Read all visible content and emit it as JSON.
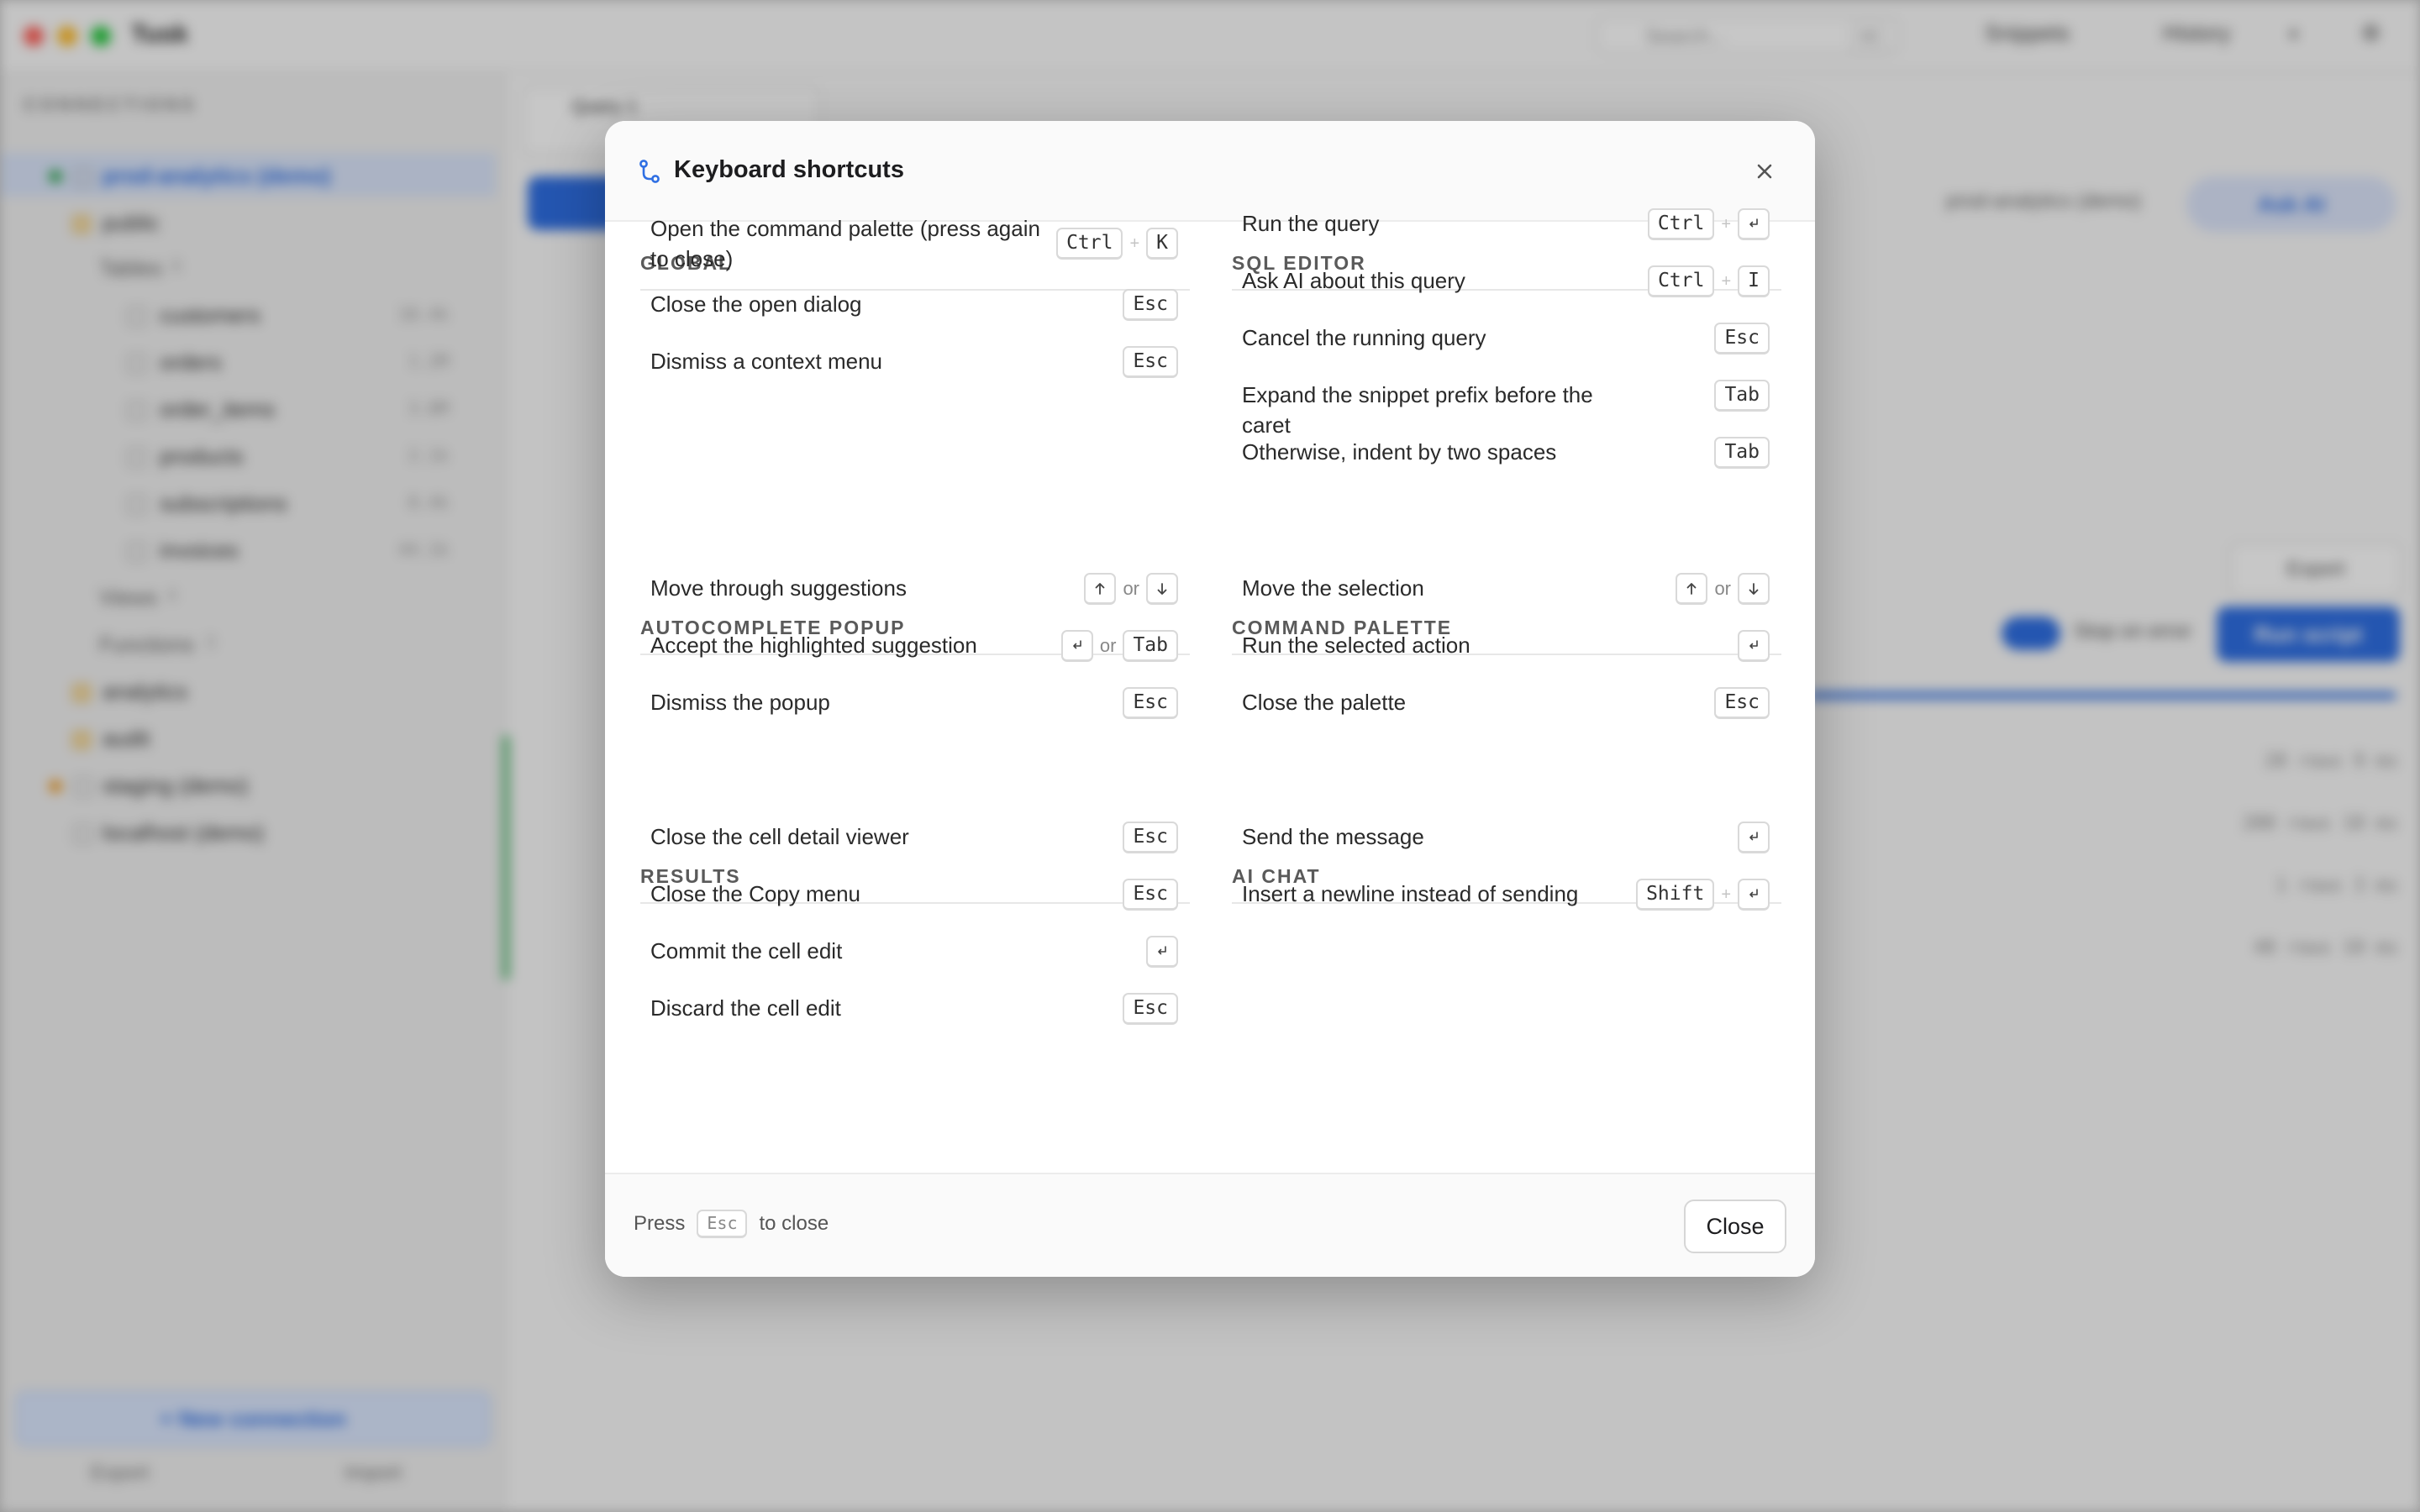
{
  "app": {
    "title": "Tusk",
    "search_placeholder": "Search...",
    "search_shortcut": "⌘K",
    "snippets_label": "Snippets",
    "history_label": "History",
    "connections_header": "CONNECTIONS",
    "tree": [
      {
        "label": "prod-analytics (demo)",
        "count": ""
      },
      {
        "label": "public",
        "count": ""
      },
      {
        "label": "Tables",
        "count": "6"
      },
      {
        "label": "customers",
        "count": "18.4k"
      },
      {
        "label": "orders",
        "count": "1.2M"
      },
      {
        "label": "order_items",
        "count": "3.8M"
      },
      {
        "label": "products",
        "count": "2.1k"
      },
      {
        "label": "subscriptions",
        "count": "8.4k"
      },
      {
        "label": "invoices",
        "count": "44.1k"
      },
      {
        "label": "Views",
        "count": "4"
      },
      {
        "label": "Functions",
        "count": "3"
      },
      {
        "label": "analytics",
        "count": ""
      },
      {
        "label": "audit",
        "count": ""
      },
      {
        "label": "staging (demo)",
        "count": ""
      },
      {
        "label": "localhost (demo)",
        "count": ""
      }
    ],
    "new_connection": "New connection",
    "export_label": "Export",
    "import_label": "Import",
    "query_tab": "Query 1",
    "conn_pill": "prod-analytics (demo)",
    "ask_ai": "Ask AI",
    "export_btn": "Export",
    "stop_on_error": "Stop on error",
    "run_script": "Run script",
    "results": [
      "28 rows 9 ms",
      "200 rows 18 ms",
      "1 rows 3 ms",
      "48 rows 10 ms"
    ]
  },
  "modal": {
    "title": "Keyboard shortcuts",
    "sections": [
      {
        "title": "GLOBAL",
        "items": [
          {
            "label": "Open the command palette (press again to close)",
            "keys": [
              "Ctrl",
              "+",
              "K"
            ]
          },
          {
            "label": "Close the open dialog",
            "keys": [
              "Esc"
            ]
          },
          {
            "label": "Dismiss a context menu",
            "keys": [
              "Esc"
            ]
          }
        ]
      },
      {
        "title": "SQL EDITOR",
        "items": [
          {
            "label": "Run the query",
            "keys": [
              "Ctrl",
              "+",
              "enter-icon"
            ]
          },
          {
            "label": "Ask AI about this query",
            "keys": [
              "Ctrl",
              "+",
              "I"
            ]
          },
          {
            "label": "Cancel the running query",
            "keys": [
              "Esc"
            ]
          },
          {
            "label": "Expand the snippet prefix before the caret",
            "keys": [
              "Tab"
            ]
          },
          {
            "label": "Otherwise, indent by two spaces",
            "keys": [
              "Tab"
            ]
          }
        ]
      },
      {
        "title": "AUTOCOMPLETE POPUP",
        "items": [
          {
            "label": "Move through suggestions",
            "keys": [
              "arrow-up-icon",
              "or",
              "arrow-down-icon"
            ]
          },
          {
            "label": "Accept the highlighted suggestion",
            "keys": [
              "enter-icon",
              "or",
              "Tab"
            ]
          },
          {
            "label": "Dismiss the popup",
            "keys": [
              "Esc"
            ]
          }
        ]
      },
      {
        "title": "COMMAND PALETTE",
        "items": [
          {
            "label": "Move the selection",
            "keys": [
              "arrow-up-icon",
              "or",
              "arrow-down-icon"
            ]
          },
          {
            "label": "Run the selected action",
            "keys": [
              "enter-icon"
            ]
          },
          {
            "label": "Close the palette",
            "keys": [
              "Esc"
            ]
          }
        ]
      },
      {
        "title": "RESULTS",
        "items": [
          {
            "label": "Close the cell detail viewer",
            "keys": [
              "Esc"
            ]
          },
          {
            "label": "Close the Copy menu",
            "keys": [
              "Esc"
            ]
          },
          {
            "label": "Commit the cell edit",
            "keys": [
              "enter-icon"
            ]
          },
          {
            "label": "Discard the cell edit",
            "keys": [
              "Esc"
            ]
          }
        ]
      },
      {
        "title": "AI CHAT",
        "items": [
          {
            "label": "Send the message",
            "keys": [
              "enter-icon"
            ]
          },
          {
            "label": "Insert a newline instead of sending",
            "keys": [
              "Shift",
              "+",
              "enter-icon"
            ]
          }
        ]
      }
    ],
    "footer": {
      "press": "Press",
      "key": "Esc",
      "to_close": "to close",
      "close_button": "Close"
    }
  },
  "colors": {
    "accent": "#2f6fe3",
    "success": "#34a853",
    "warning": "#f0a030"
  }
}
